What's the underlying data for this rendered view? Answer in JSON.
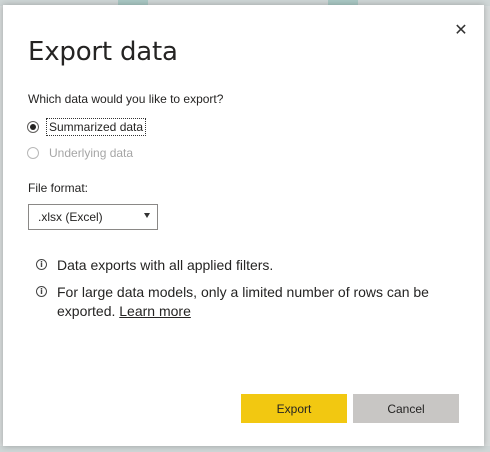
{
  "dialog": {
    "title": "Export data",
    "close_glyph": "✕",
    "question": "Which data would you like to export?",
    "options": [
      {
        "label": "Summarized data",
        "selected": true,
        "enabled": true
      },
      {
        "label": "Underlying data",
        "selected": false,
        "enabled": false
      }
    ],
    "file_format_label": "File format:",
    "file_format_value": ".xlsx (Excel)",
    "info_icon_glyph": "i",
    "info_1": "Data exports with all applied filters.",
    "info_2": "For large data models, only a limited number of rows can be exported.",
    "learn_more": "Learn more",
    "export_label": "Export",
    "cancel_label": "Cancel"
  },
  "colors": {
    "export_button": "#f2c811",
    "cancel_button": "#c8c6c4",
    "text": "#252423"
  }
}
